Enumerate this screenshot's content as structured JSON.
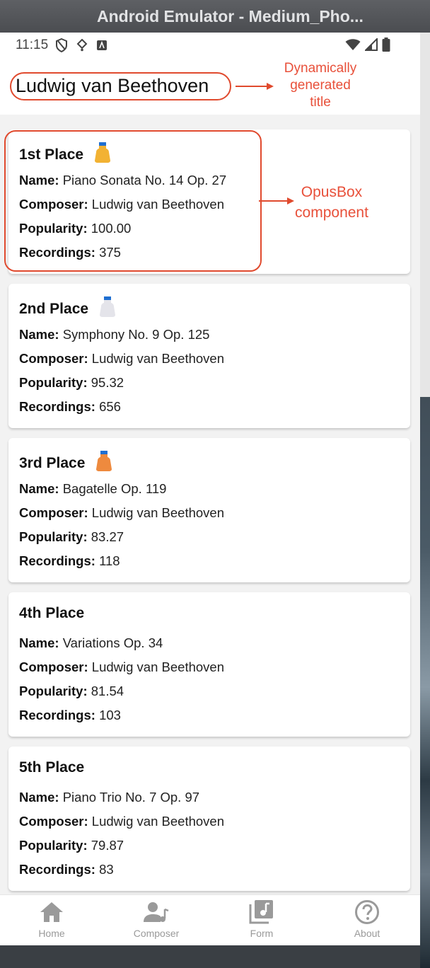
{
  "window": {
    "title": "Android Emulator - Medium_Pho..."
  },
  "status_bar": {
    "time": "11:15",
    "icons": [
      "shield-icon",
      "usb-debug-icon",
      "accessibility-icon",
      "wifi-icon",
      "signal-icon",
      "battery-icon"
    ]
  },
  "app": {
    "title": "Ludwig van Beethoven"
  },
  "annotations": {
    "title_note": [
      "Dynamically",
      "generated",
      "title"
    ],
    "opus_note": [
      "OpusBox",
      "component"
    ],
    "color": "#e04a2e"
  },
  "labels": {
    "name": "Name:",
    "composer": "Composer:",
    "popularity": "Popularity:",
    "recordings": "Recordings:"
  },
  "cards": [
    {
      "place": "1st Place",
      "medal": "gold",
      "name": "Piano Sonata No. 14 Op. 27",
      "composer": "Ludwig van Beethoven",
      "popularity": "100.00",
      "recordings": "375"
    },
    {
      "place": "2nd Place",
      "medal": "silver",
      "name": "Symphony No. 9 Op. 125",
      "composer": "Ludwig van Beethoven",
      "popularity": "95.32",
      "recordings": "656"
    },
    {
      "place": "3rd Place",
      "medal": "bronze",
      "name": "Bagatelle Op. 119",
      "composer": "Ludwig van Beethoven",
      "popularity": "83.27",
      "recordings": "118"
    },
    {
      "place": "4th Place",
      "medal": "",
      "name": "Variations Op. 34",
      "composer": "Ludwig van Beethoven",
      "popularity": "81.54",
      "recordings": "103"
    },
    {
      "place": "5th Place",
      "medal": "",
      "name": "Piano Trio No. 7 Op. 97",
      "composer": "Ludwig van Beethoven",
      "popularity": "79.87",
      "recordings": "83"
    }
  ],
  "nav": [
    {
      "label": "Home",
      "icon": "home-icon"
    },
    {
      "label": "Composer",
      "icon": "composer-icon"
    },
    {
      "label": "Form",
      "icon": "library-music-icon"
    },
    {
      "label": "About",
      "icon": "help-icon"
    }
  ],
  "colors": {
    "medal_gold": "#f2b233",
    "medal_silver": "#e4e4ea",
    "medal_bronze": "#ee8a3e",
    "ribbon": "#1f6fd1"
  }
}
